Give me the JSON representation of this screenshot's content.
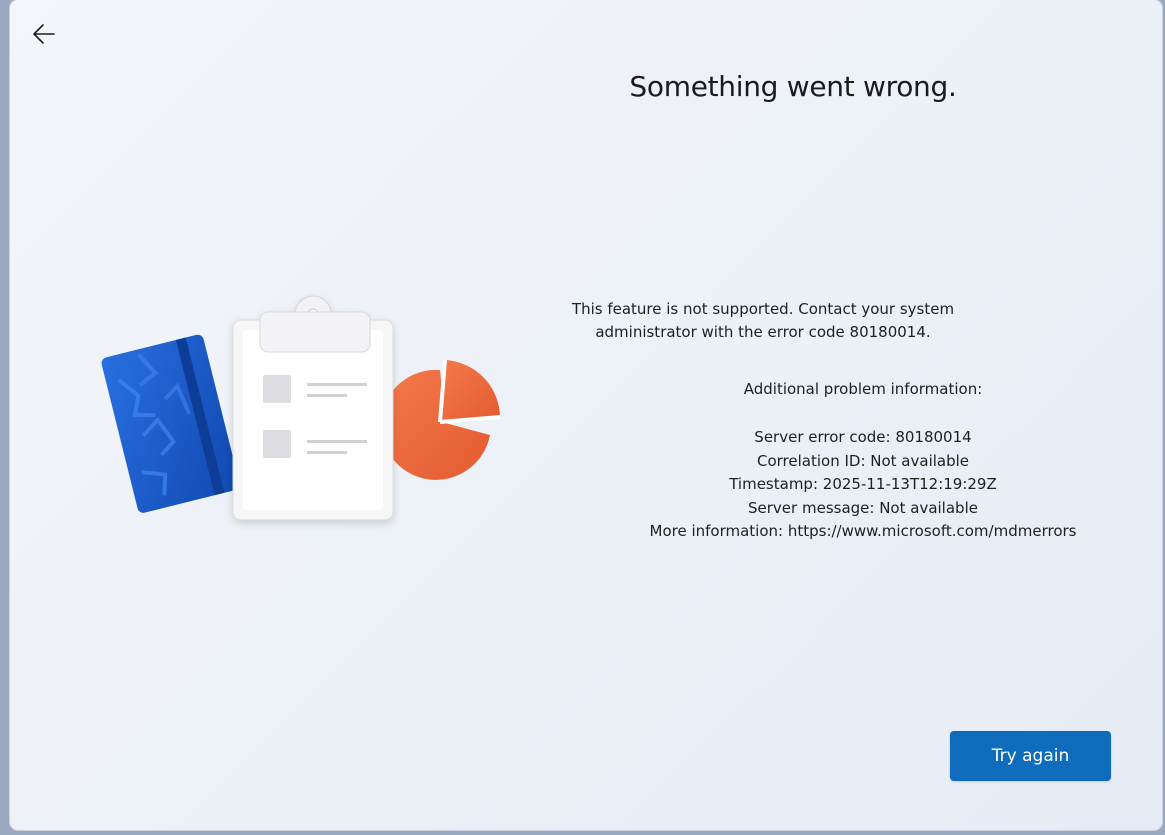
{
  "header": {
    "back_icon": "arrow-left-icon"
  },
  "main": {
    "title": "Something went wrong.",
    "message_lines": [
      "This feature is not supported. Contact your system",
      "administrator with the error code 80180014."
    ],
    "additional_header": "Additional problem information:",
    "details": [
      "Server error code: 80180014",
      "Correlation ID: Not available",
      "Timestamp: 2025-11-13T12:19:29Z",
      "Server message: Not available",
      "More information: https://www.microsoft.com/mdmerrors"
    ]
  },
  "footer": {
    "try_again_label": "Try again"
  },
  "illustration": {
    "icons": [
      "notebook-icon",
      "clipboard-icon",
      "pie-chart-icon"
    ]
  },
  "colors": {
    "accent": "#0f6cbd",
    "notebook": "#1a5fd0",
    "pie": "#ef6b3f"
  }
}
